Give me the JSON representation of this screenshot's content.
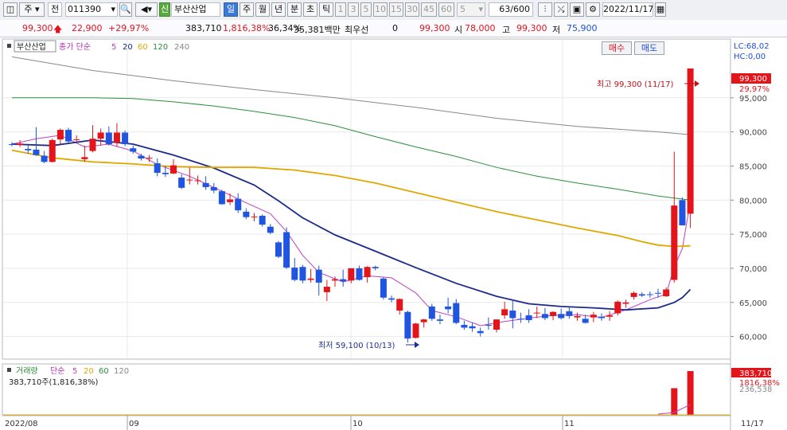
{
  "toolbar": {
    "market": "주",
    "jeon": "전",
    "code": "011390",
    "name_badge": "신",
    "name": "부산산업",
    "periods": [
      "일",
      "주",
      "월",
      "년",
      "분",
      "초",
      "틱"
    ],
    "period_selected": "일",
    "intervals": [
      "1",
      "3",
      "5",
      "10",
      "15",
      "30",
      "45",
      "60"
    ],
    "interval_value": "5",
    "count": "63/600",
    "date": "2022/11/17"
  },
  "info": {
    "price": "99,300",
    "change": "22,900",
    "change_rate": "+29,97%",
    "volume": "383,710",
    "volume_rate": "1,816,38%",
    "turnover": "36,34%",
    "amount": "35,381백만",
    "preferred_label": "최우선",
    "preferred_value": "0",
    "open_price": "99,300",
    "open_label": "시",
    "open_value": "78,000",
    "high_label": "고",
    "high_value": "99,300",
    "low_label": "저",
    "low_value": "75,900",
    "buy_label": "매수",
    "sell_label": "매도"
  },
  "legend": {
    "stock": "부산산업",
    "ma_title": "종가 단순",
    "ma_periods": [
      "5",
      "20",
      "60",
      "120",
      "240"
    ],
    "ma_colors": [
      "#c040c0",
      "#1c2a8a",
      "#e0a800",
      "#2d8f3a",
      "#888888"
    ],
    "lc": "LC:68,02",
    "hc": "HC:0,00"
  },
  "volume_legend": {
    "title": "거래량",
    "ma_title": "단순",
    "ma_periods": [
      "5",
      "20",
      "60",
      "120"
    ],
    "value_line": "383,710주(1,816,38%)"
  },
  "colors": {
    "up": "#e3151b",
    "down": "#1f55e0"
  },
  "chart_data": {
    "type": "candlestick",
    "y_axis_ticks": [
      "95,000",
      "90,000",
      "85,000",
      "80,000",
      "75,000",
      "70,000",
      "65,000",
      "60,000"
    ],
    "ylim": [
      56800,
      103500
    ],
    "last_price_label": "99,300",
    "last_change_label": "29,97%",
    "volume_labels": [
      "383,710",
      "1816,38%",
      "236,538"
    ],
    "x_labels": [
      "2022/08",
      "09",
      "10",
      "11",
      "11/17"
    ],
    "annotations": {
      "high": "최고 99,300 (11/17)",
      "low": "최저 59,100 (10/13)"
    },
    "candles": [
      [
        88200,
        88500,
        87900,
        88100
      ],
      [
        88100,
        88800,
        87800,
        88300
      ],
      [
        87500,
        88000,
        86800,
        87300
      ],
      [
        87400,
        90700,
        86500,
        86600
      ],
      [
        86500,
        87200,
        85400,
        85600
      ],
      [
        85600,
        89000,
        85500,
        88800
      ],
      [
        88900,
        90500,
        88200,
        90300
      ],
      [
        90300,
        90600,
        88400,
        88600
      ],
      [
        88800,
        89500,
        88600,
        88900
      ],
      [
        86000,
        88000,
        85600,
        86300
      ],
      [
        87200,
        91000,
        87000,
        89000
      ],
      [
        89000,
        90500,
        88000,
        89900
      ],
      [
        89900,
        90800,
        88000,
        88200
      ],
      [
        88400,
        91300,
        87800,
        89900
      ],
      [
        89900,
        90200,
        87900,
        88200
      ],
      [
        87600,
        88000,
        86800,
        87100
      ],
      [
        86500,
        86800,
        85800,
        86100
      ],
      [
        86100,
        86600,
        85600,
        86200
      ],
      [
        85400,
        86100,
        83500,
        84000
      ],
      [
        84000,
        85000,
        83400,
        83800
      ],
      [
        83900,
        86000,
        83800,
        85100
      ],
      [
        83300,
        83800,
        81600,
        81800
      ],
      [
        83000,
        84800,
        82300,
        83000
      ],
      [
        82900,
        83600,
        82300,
        82900
      ],
      [
        82500,
        83500,
        81500,
        81900
      ],
      [
        81900,
        82500,
        81000,
        81400
      ],
      [
        81300,
        81500,
        79300,
        79400
      ],
      [
        79700,
        81000,
        79300,
        80100
      ],
      [
        80200,
        81000,
        78100,
        78500
      ],
      [
        78300,
        78800,
        77200,
        77500
      ],
      [
        77600,
        78100,
        76900,
        77600
      ],
      [
        77700,
        77900,
        76100,
        76400
      ],
      [
        76100,
        76500,
        75000,
        75200
      ],
      [
        73800,
        74000,
        71500,
        71700
      ],
      [
        75300,
        76000,
        69900,
        70100
      ],
      [
        70100,
        71500,
        68100,
        68300
      ],
      [
        70200,
        70500,
        67800,
        68200
      ],
      [
        68300,
        69900,
        67900,
        68500
      ],
      [
        69800,
        70400,
        66000,
        67900
      ],
      [
        66500,
        68300,
        65200,
        67300
      ],
      [
        68200,
        68800,
        67300,
        68400
      ],
      [
        68400,
        69800,
        67300,
        68100
      ],
      [
        68200,
        70000,
        67800,
        70000
      ],
      [
        70000,
        70400,
        68200,
        68300
      ],
      [
        68700,
        70300,
        67900,
        70200
      ],
      [
        70200,
        70400,
        69700,
        70000
      ],
      [
        68500,
        68700,
        65400,
        65700
      ],
      [
        65600,
        66000,
        65000,
        65400
      ],
      [
        63800,
        65600,
        63200,
        65500
      ],
      [
        63600,
        63800,
        59100,
        59700
      ],
      [
        59800,
        62000,
        59700,
        61900
      ],
      [
        62100,
        62600,
        61300,
        62500
      ],
      [
        64400,
        64800,
        62300,
        62600
      ],
      [
        62500,
        63200,
        61800,
        62300
      ],
      [
        64400,
        65700,
        63400,
        64000
      ],
      [
        64900,
        65500,
        61800,
        62000
      ],
      [
        61700,
        62300,
        61000,
        61300
      ],
      [
        61500,
        62000,
        60700,
        61200
      ],
      [
        60800,
        61300,
        60000,
        60500
      ],
      [
        61700,
        62800,
        61000,
        61600
      ],
      [
        61000,
        62500,
        60600,
        62500
      ],
      [
        63100,
        65100,
        62600,
        64000
      ],
      [
        63800,
        65400,
        61200,
        62700
      ],
      [
        62600,
        63500,
        62000,
        62500
      ],
      [
        63100,
        64000,
        62000,
        62400
      ],
      [
        63400,
        64400,
        62700,
        63500
      ],
      [
        63300,
        64200,
        62400,
        62700
      ],
      [
        63000,
        63700,
        62400,
        63600
      ],
      [
        63300,
        64100,
        62500,
        62700
      ],
      [
        63700,
        64300,
        62600,
        63000
      ],
      [
        62800,
        63500,
        62300,
        63000
      ],
      [
        62600,
        63200,
        61900,
        62000
      ],
      [
        62800,
        63600,
        62100,
        63200
      ],
      [
        62900,
        63400,
        62300,
        62700
      ],
      [
        62900,
        63700,
        62300,
        63100
      ],
      [
        63400,
        65300,
        63100,
        65100
      ],
      [
        64800,
        65400,
        64200,
        65000
      ],
      [
        65800,
        66600,
        65400,
        66400
      ],
      [
        66200,
        66500,
        65800,
        66000
      ],
      [
        66200,
        66600,
        65700,
        66100
      ],
      [
        66400,
        67000,
        65700,
        66300
      ],
      [
        65900,
        67200,
        65800,
        66900
      ],
      [
        68300,
        87100,
        67900,
        79200
      ],
      [
        80000,
        80400,
        76400,
        76300
      ],
      [
        78000,
        99300,
        75900,
        99300
      ]
    ],
    "volume_high_bars": [
      {
        "index": 82,
        "value": 236538
      },
      {
        "index": 84,
        "value": 383710
      }
    ],
    "ma": {
      "5": [
        [
          0,
          88200
        ],
        [
          3,
          89000
        ],
        [
          6,
          89500
        ],
        [
          9,
          87800
        ],
        [
          12,
          88200
        ],
        [
          15,
          87200
        ],
        [
          18,
          85200
        ],
        [
          22,
          83500
        ],
        [
          26,
          81300
        ],
        [
          29,
          79600
        ],
        [
          32,
          78000
        ],
        [
          34,
          75400
        ],
        [
          36,
          71900
        ],
        [
          38,
          69400
        ],
        [
          41,
          68000
        ],
        [
          44,
          68900
        ],
        [
          47,
          68600
        ],
        [
          50,
          66400
        ],
        [
          52,
          63800
        ],
        [
          55,
          62900
        ],
        [
          58,
          61600
        ],
        [
          61,
          62200
        ],
        [
          64,
          62700
        ],
        [
          67,
          63100
        ],
        [
          70,
          63200
        ],
        [
          73,
          62800
        ],
        [
          76,
          63900
        ],
        [
          79,
          65400
        ],
        [
          81,
          66200
        ],
        [
          82,
          70200
        ],
        [
          83,
          72900
        ],
        [
          84,
          79900
        ]
      ],
      "20": [
        [
          0,
          88200
        ],
        [
          5,
          88000
        ],
        [
          10,
          88800
        ],
        [
          15,
          88200
        ],
        [
          20,
          86600
        ],
        [
          25,
          84700
        ],
        [
          30,
          82200
        ],
        [
          33,
          79900
        ],
        [
          36,
          77400
        ],
        [
          40,
          74900
        ],
        [
          45,
          72500
        ],
        [
          50,
          70100
        ],
        [
          55,
          67800
        ],
        [
          60,
          65900
        ],
        [
          64,
          64800
        ],
        [
          68,
          64400
        ],
        [
          72,
          64200
        ],
        [
          76,
          63900
        ],
        [
          80,
          64200
        ],
        [
          82,
          65000
        ],
        [
          83,
          65700
        ],
        [
          84,
          66900
        ]
      ],
      "60": [
        [
          0,
          87300
        ],
        [
          5,
          86200
        ],
        [
          10,
          85600
        ],
        [
          15,
          85300
        ],
        [
          20,
          84900
        ],
        [
          25,
          84800
        ],
        [
          30,
          84800
        ],
        [
          35,
          84400
        ],
        [
          40,
          83600
        ],
        [
          45,
          82500
        ],
        [
          50,
          81100
        ],
        [
          55,
          79700
        ],
        [
          60,
          78300
        ],
        [
          65,
          77100
        ],
        [
          70,
          75900
        ],
        [
          75,
          74800
        ],
        [
          78,
          73900
        ],
        [
          80,
          73400
        ],
        [
          82,
          73200
        ],
        [
          84,
          73300
        ]
      ],
      "120": [
        [
          0,
          95000
        ],
        [
          10,
          95000
        ],
        [
          15,
          94900
        ],
        [
          20,
          94400
        ],
        [
          25,
          93800
        ],
        [
          30,
          93000
        ],
        [
          35,
          92100
        ],
        [
          40,
          90900
        ],
        [
          45,
          89300
        ],
        [
          50,
          87800
        ],
        [
          55,
          86400
        ],
        [
          60,
          84800
        ],
        [
          65,
          83500
        ],
        [
          70,
          82500
        ],
        [
          75,
          81600
        ],
        [
          80,
          80600
        ],
        [
          84,
          80000
        ]
      ],
      "240": [
        [
          0,
          101000
        ],
        [
          10,
          99000
        ],
        [
          20,
          97500
        ],
        [
          30,
          96200
        ],
        [
          40,
          95000
        ],
        [
          50,
          93600
        ],
        [
          60,
          92000
        ],
        [
          70,
          90800
        ],
        [
          80,
          90000
        ],
        [
          84,
          89600
        ]
      ]
    }
  }
}
